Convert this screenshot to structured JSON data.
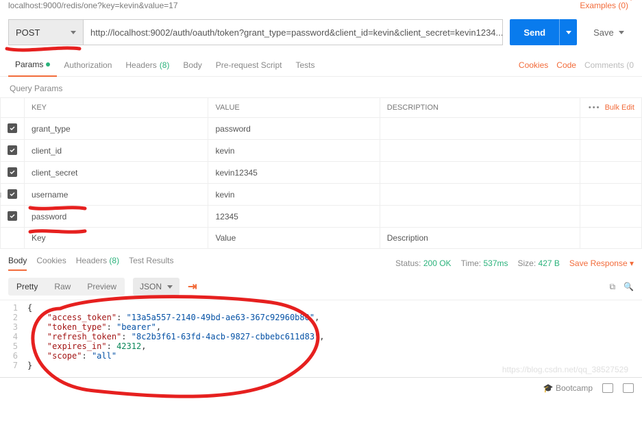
{
  "header": {
    "breadcrumb": "localhost:9000/redis/one?key=kevin&value=17",
    "examples_label": "Examples (0)"
  },
  "request": {
    "method": "POST",
    "url": "http://localhost:9002/auth/oauth/token?grant_type=password&client_id=kevin&client_secret=kevin1234...",
    "send_label": "Send",
    "save_label": "Save"
  },
  "tabs": {
    "items": [
      {
        "label": "Params",
        "active": true,
        "dot": true
      },
      {
        "label": "Authorization"
      },
      {
        "label": "Headers",
        "badge": "(8)"
      },
      {
        "label": "Body"
      },
      {
        "label": "Pre-request Script"
      },
      {
        "label": "Tests"
      }
    ],
    "right": {
      "cookies": "Cookies",
      "code": "Code",
      "comments": "Comments (0"
    }
  },
  "query": {
    "title": "Query Params",
    "cols": {
      "key": "KEY",
      "value": "VALUE",
      "desc": "DESCRIPTION"
    },
    "bulk": "Bulk Edit",
    "rows": [
      {
        "checked": true,
        "key": "grant_type",
        "value": "password"
      },
      {
        "checked": true,
        "key": "client_id",
        "value": "kevin"
      },
      {
        "checked": true,
        "key": "client_secret",
        "value": "kevin12345"
      },
      {
        "checked": true,
        "key": "username",
        "value": "kevin"
      },
      {
        "checked": true,
        "key": "password",
        "value": "12345"
      }
    ],
    "placeholder": {
      "key": "Key",
      "value": "Value",
      "desc": "Description"
    }
  },
  "response": {
    "tabs": [
      {
        "label": "Body",
        "active": true
      },
      {
        "label": "Cookies"
      },
      {
        "label": "Headers",
        "badge": "(8)"
      },
      {
        "label": "Test Results"
      }
    ],
    "status_label": "Status:",
    "status_value": "200 OK",
    "time_label": "Time:",
    "time_value": "537ms",
    "size_label": "Size:",
    "size_value": "427 B",
    "save_response": "Save Response",
    "view": {
      "pretty": "Pretty",
      "raw": "Raw",
      "preview": "Preview",
      "format": "JSON"
    },
    "json_lines": [
      {
        "n": "1",
        "t": "{"
      },
      {
        "n": "2",
        "t": "    \"access_token\": \"13a5a557-2140-49bd-ae63-367c92960b80\","
      },
      {
        "n": "3",
        "t": "    \"token_type\": \"bearer\","
      },
      {
        "n": "4",
        "t": "    \"refresh_token\": \"8c2b3f61-63fd-4acb-9827-cbbebc611d83\","
      },
      {
        "n": "5",
        "t": "    \"expires_in\": 42312,"
      },
      {
        "n": "6",
        "t": "    \"scope\": \"all\""
      },
      {
        "n": "7",
        "t": "}"
      }
    ],
    "data": {
      "access_token": "13a5a557-2140-49bd-ae63-367c92960b80",
      "token_type": "bearer",
      "refresh_token": "8c2b3f61-63fd-4acb-9827-cbbebc611d83",
      "expires_in": 42312,
      "scope": "all"
    }
  },
  "footer": {
    "bootcamp": "Bootcamp"
  },
  "watermark": "https://blog.csdn.net/qq_38527529"
}
